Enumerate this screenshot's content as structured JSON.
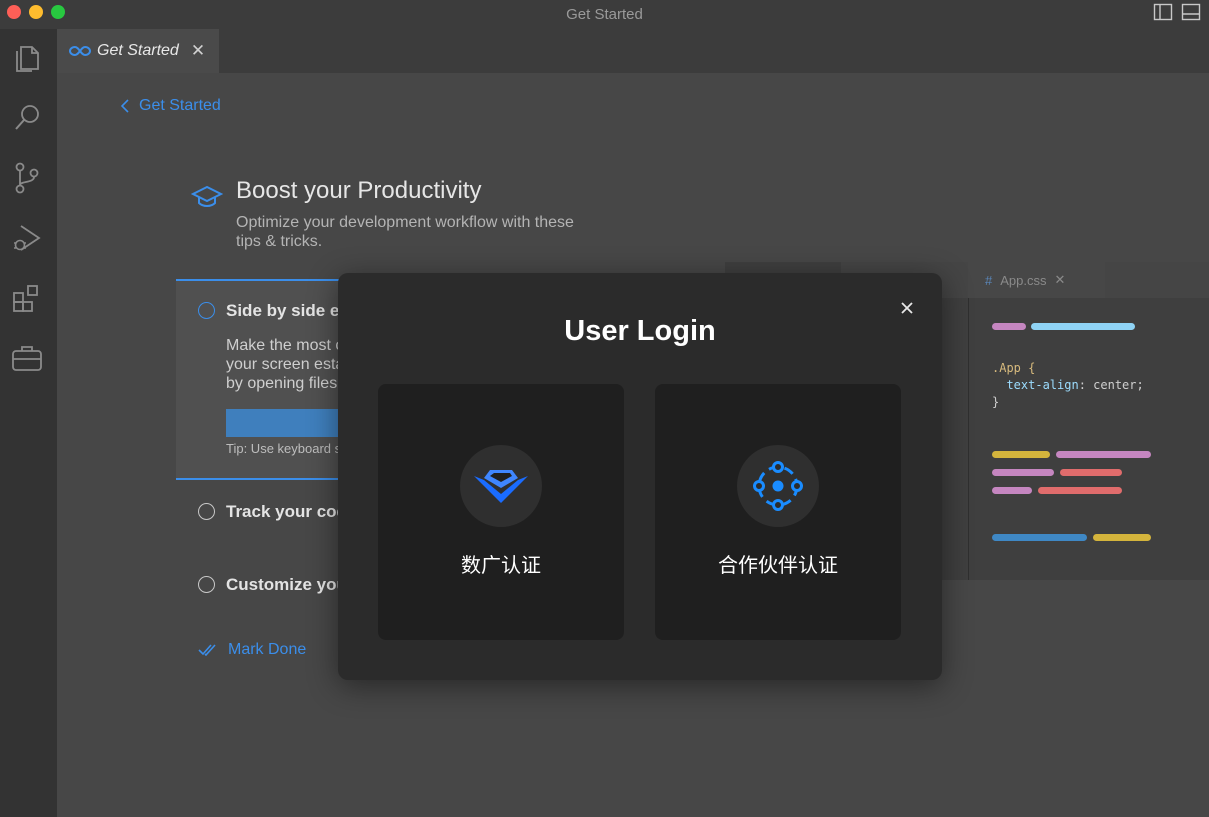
{
  "window": {
    "title": "Get Started"
  },
  "tab": {
    "label": "Get Started",
    "close": "✕"
  },
  "page": {
    "back_label": "Get Started",
    "title": "Boost your Productivity",
    "subtitle": "Optimize your development workflow with these tips & tricks."
  },
  "steps": {
    "active_title": "Side by side editing",
    "active_desc": "Make the most of your screen estate by opening files side by side, vertically and horizontally.",
    "active_tip": "Tip: Use keyboard shortcut",
    "step2_title": "Track your code",
    "step3_title": "Customize your editor",
    "mark_done": "Mark Done"
  },
  "preview": {
    "tab_label": "App.css",
    "tab_hash": "#",
    "tab_close": "✕",
    "code": {
      "selector": ".App {",
      "prop": "text-align",
      "value": "center;",
      "close": "}"
    }
  },
  "modal": {
    "title": "User Login",
    "cards": [
      {
        "label": "数广认证",
        "icon": "shuguang-logo-icon"
      },
      {
        "label": "合作伙伴认证",
        "icon": "partner-network-icon"
      }
    ]
  },
  "colors": {
    "accent": "#3b8eea",
    "modal_bg": "#2b2b2b",
    "card_bg": "#1f1f1f",
    "logo_blue": "#1a6cff"
  }
}
